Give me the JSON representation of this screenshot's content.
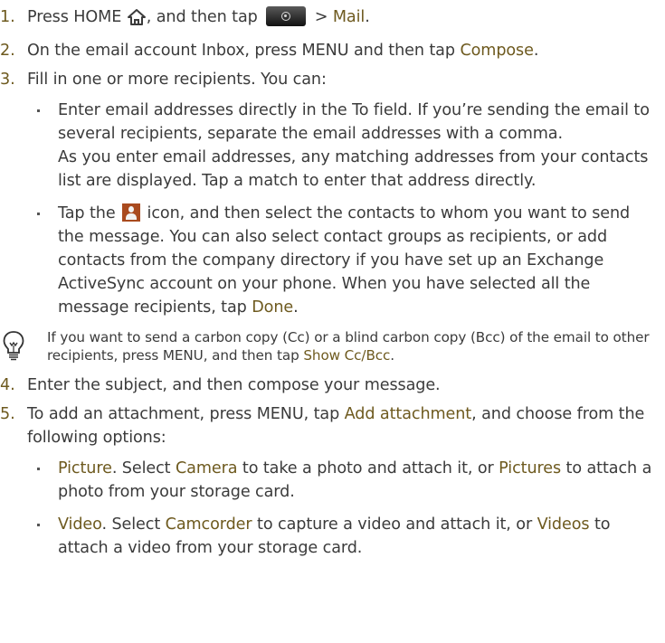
{
  "steps": [
    {
      "num": "1.",
      "parts": [
        "Press HOME ",
        ", and then tap ",
        " > ",
        "Mail",
        "."
      ]
    },
    {
      "num": "2.",
      "parts": [
        "On the email account Inbox, press MENU and then tap ",
        "Compose",
        "."
      ]
    },
    {
      "num": "3.",
      "text": "Fill in one or more recipients. You can:",
      "bullets": [
        {
          "p1": "Enter email addresses directly in the To field. If you’re sending the email to several recipients, separate the email addresses with a comma.",
          "p2": "As you enter email addresses, any matching addresses from your contacts list are displayed. Tap a match to enter that address directly."
        },
        {
          "parts": [
            "Tap the ",
            " icon, and then select the contacts to whom you want to send the message. You can also select contact groups as recipients, or add contacts from the company directory if you have set up an Exchange ActiveSync account on your phone. When you have selected all the message recipients, tap ",
            "Done",
            "."
          ]
        }
      ]
    },
    {
      "num": "4.",
      "text": "Enter the subject, and then compose your message."
    },
    {
      "num": "5.",
      "parts": [
        "To add an attachment, press MENU, tap ",
        "Add attachment",
        ", and choose from the following options:"
      ],
      "bullets": [
        {
          "parts": [
            "Picture",
            ". Select ",
            "Camera",
            " to take a photo and attach it, or ",
            "Pictures",
            " to attach a photo from your storage card."
          ]
        },
        {
          "parts": [
            "Video",
            ". Select ",
            "Camcorder",
            " to capture a video and attach it, or ",
            "Videos",
            " to attach a video from your storage card."
          ]
        }
      ]
    }
  ],
  "tip": {
    "parts": [
      "If you want to send a carbon copy (Cc) or a blind carbon copy (Bcc) of the email to other recipients, press MENU, and then tap ",
      "Show Cc/Bcc",
      "."
    ]
  },
  "icons": {
    "home": "home-icon",
    "camera_button": "camera-button-icon",
    "contact": "person-icon",
    "tip": "lightbulb-icon"
  },
  "colors": {
    "highlight": "#6e5a1f",
    "text": "#3b3b3b",
    "contact_icon": "#a94a1e"
  }
}
